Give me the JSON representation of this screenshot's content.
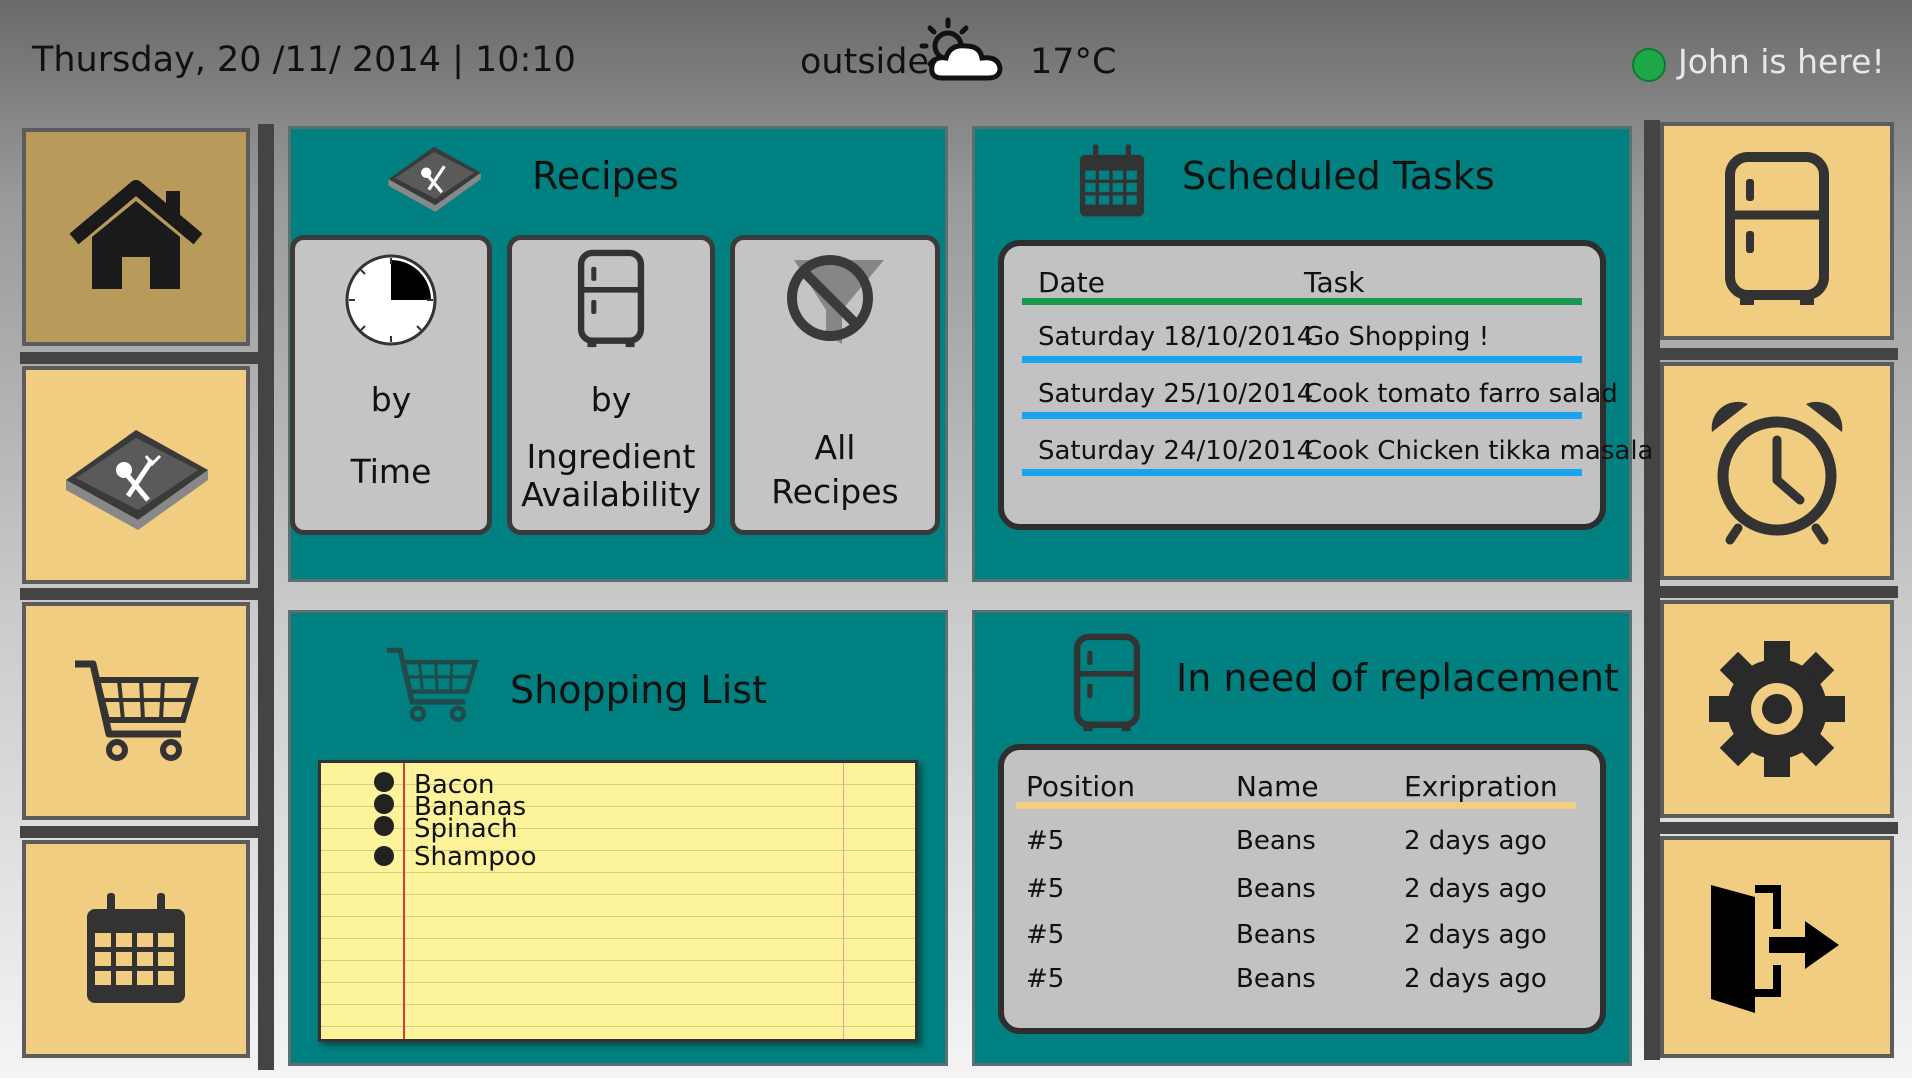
{
  "header": {
    "datetime": "Thursday, 20 /11/ 2014 | 10:10",
    "outside_label": "outside",
    "weather_icon": "partly-cloudy-icon",
    "temperature": "17°C",
    "user_status": "John is here!",
    "status_color": "#1fa84a"
  },
  "left_nav": [
    {
      "name": "home",
      "icon": "home-icon"
    },
    {
      "name": "recipes",
      "icon": "recipe-book-icon"
    },
    {
      "name": "shopping",
      "icon": "cart-icon"
    },
    {
      "name": "calendar",
      "icon": "calendar-icon"
    }
  ],
  "right_nav": [
    {
      "name": "fridge",
      "icon": "fridge-icon"
    },
    {
      "name": "alarm",
      "icon": "alarm-clock-icon"
    },
    {
      "name": "settings",
      "icon": "gear-icon"
    },
    {
      "name": "logout",
      "icon": "exit-icon"
    }
  ],
  "recipes": {
    "title": "Recipes",
    "by_time": {
      "line1": "by",
      "line2": "Time"
    },
    "by_ingredient": {
      "line1": "by",
      "line2": "Ingredient",
      "line3": "Availability"
    },
    "all": {
      "line1": "All",
      "line2": "Recipes"
    }
  },
  "tasks": {
    "title": "Scheduled Tasks",
    "headers": {
      "date": "Date",
      "task": "Task"
    },
    "rows": [
      {
        "date": "Saturday 18/10/2014",
        "task": "Go Shopping !"
      },
      {
        "date": "Saturday 25/10/2014",
        "task": "Cook tomato farro salad"
      },
      {
        "date": "Saturday 24/10/2014",
        "task": "Cook Chicken tikka masala"
      }
    ]
  },
  "shopping": {
    "title": "Shopping List",
    "items": [
      "Bacon",
      "Bananas",
      "Spinach",
      "Shampoo"
    ]
  },
  "replacement": {
    "title": "In need of replacement",
    "headers": {
      "position": "Position",
      "name": "Name",
      "expiration": "Exripration"
    },
    "rows": [
      {
        "position": "#5",
        "name": "Beans",
        "expiration": "2 days ago"
      },
      {
        "position": "#5",
        "name": "Beans",
        "expiration": "2 days ago"
      },
      {
        "position": "#5",
        "name": "Beans",
        "expiration": "2 days ago"
      },
      {
        "position": "#5",
        "name": "Beans",
        "expiration": "2 days ago"
      }
    ]
  },
  "colors": {
    "panel": "#008080",
    "tile": "#f0cd80",
    "tile_active": "#b89a5a",
    "task_header_line": "#1a9a50",
    "task_row_line": "#1aa3f0",
    "replacement_header_line": "#f0cd80"
  }
}
